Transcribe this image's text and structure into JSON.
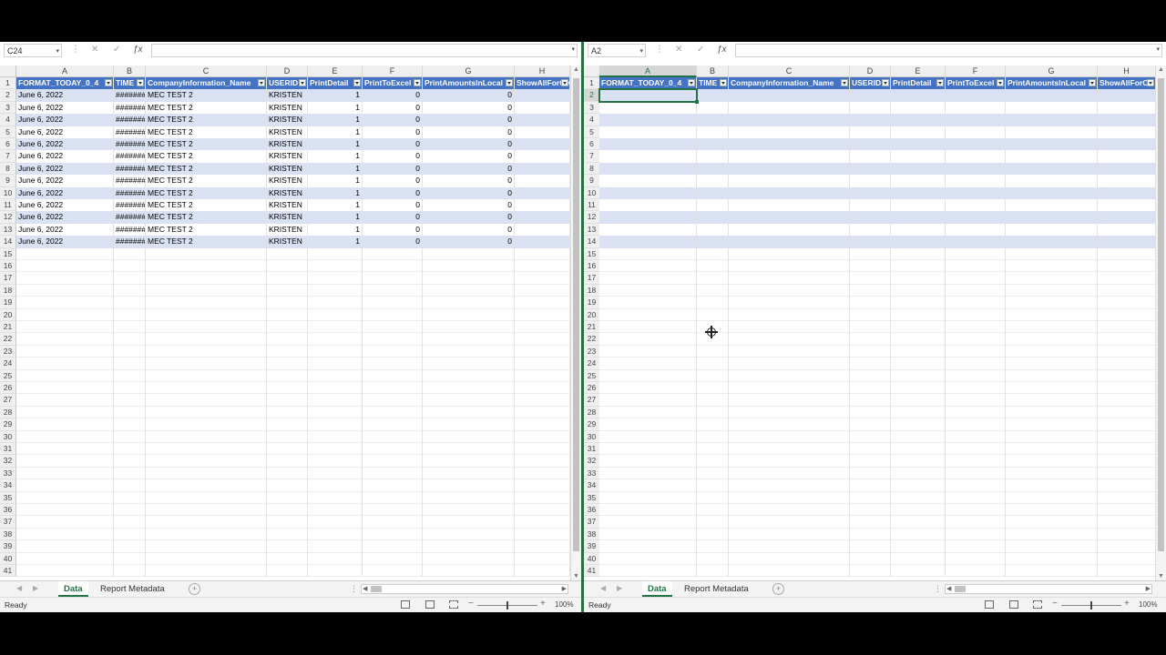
{
  "columns": [
    {
      "letter": "A",
      "header": "FORMAT_TODAY_0_4",
      "align": "left"
    },
    {
      "letter": "B",
      "header": "TIME",
      "align": "left"
    },
    {
      "letter": "C",
      "header": "CompanyInformation_Name",
      "align": "left"
    },
    {
      "letter": "D",
      "header": "USERID",
      "align": "left"
    },
    {
      "letter": "E",
      "header": "PrintDetail",
      "align": "right"
    },
    {
      "letter": "F",
      "header": "PrintToExcel",
      "align": "right"
    },
    {
      "letter": "G",
      "header": "PrintAmountsInLocal",
      "align": "right"
    },
    {
      "letter": "H",
      "header": "ShowAllForOv",
      "align": "left"
    }
  ],
  "left": {
    "name_box": "C24",
    "data_rows": [
      [
        "June 6, 2022",
        "########",
        "MEC TEST 2",
        "KRISTEN",
        "1",
        "0",
        "0",
        ""
      ],
      [
        "June 6, 2022",
        "########",
        "MEC TEST 2",
        "KRISTEN",
        "1",
        "0",
        "0",
        ""
      ],
      [
        "June 6, 2022",
        "########",
        "MEC TEST 2",
        "KRISTEN",
        "1",
        "0",
        "0",
        ""
      ],
      [
        "June 6, 2022",
        "########",
        "MEC TEST 2",
        "KRISTEN",
        "1",
        "0",
        "0",
        ""
      ],
      [
        "June 6, 2022",
        "########",
        "MEC TEST 2",
        "KRISTEN",
        "1",
        "0",
        "0",
        ""
      ],
      [
        "June 6, 2022",
        "########",
        "MEC TEST 2",
        "KRISTEN",
        "1",
        "0",
        "0",
        ""
      ],
      [
        "June 6, 2022",
        "########",
        "MEC TEST 2",
        "KRISTEN",
        "1",
        "0",
        "0",
        ""
      ],
      [
        "June 6, 2022",
        "########",
        "MEC TEST 2",
        "KRISTEN",
        "1",
        "0",
        "0",
        ""
      ],
      [
        "June 6, 2022",
        "########",
        "MEC TEST 2",
        "KRISTEN",
        "1",
        "0",
        "0",
        ""
      ],
      [
        "June 6, 2022",
        "########",
        "MEC TEST 2",
        "KRISTEN",
        "1",
        "0",
        "0",
        ""
      ],
      [
        "June 6, 2022",
        "########",
        "MEC TEST 2",
        "KRISTEN",
        "1",
        "0",
        "0",
        ""
      ],
      [
        "June 6, 2022",
        "########",
        "MEC TEST 2",
        "KRISTEN",
        "1",
        "0",
        "0",
        ""
      ],
      [
        "June 6, 2022",
        "########",
        "MEC TEST 2",
        "KRISTEN",
        "1",
        "0",
        "0",
        ""
      ]
    ]
  },
  "right": {
    "name_box": "A2",
    "selected_cell": "A2",
    "data_rows": [
      [
        "",
        "",
        "",
        "",
        "",
        "",
        "",
        ""
      ],
      [
        "",
        "",
        "",
        "",
        "",
        "",
        "",
        ""
      ],
      [
        "",
        "",
        "",
        "",
        "",
        "",
        "",
        ""
      ],
      [
        "",
        "",
        "",
        "",
        "",
        "",
        "",
        ""
      ],
      [
        "",
        "",
        "",
        "",
        "",
        "",
        "",
        ""
      ],
      [
        "",
        "",
        "",
        "",
        "",
        "",
        "",
        ""
      ],
      [
        "",
        "",
        "",
        "",
        "",
        "",
        "",
        ""
      ],
      [
        "",
        "",
        "",
        "",
        "",
        "",
        "",
        ""
      ],
      [
        "",
        "",
        "",
        "",
        "",
        "",
        "",
        ""
      ],
      [
        "",
        "",
        "",
        "",
        "",
        "",
        "",
        ""
      ],
      [
        "",
        "",
        "",
        "",
        "",
        "",
        "",
        ""
      ],
      [
        "",
        "",
        "",
        "",
        "",
        "",
        "",
        ""
      ],
      [
        "",
        "",
        "",
        "",
        "",
        "",
        "",
        ""
      ]
    ]
  },
  "total_rows_visible": 41,
  "sheets": {
    "tabs": [
      "Data",
      "Report Metadata"
    ],
    "active": "Data"
  },
  "status": {
    "ready": "Ready",
    "zoom": "100%"
  },
  "colors": {
    "accent": "#217346",
    "table_header": "#4472c4",
    "table_band": "#d9e1f2"
  },
  "icons": [
    "cancel-icon",
    "enter-icon",
    "function-icon",
    "add-sheet-icon",
    "normal-view-icon",
    "page-layout-icon",
    "page-break-icon",
    "crosshair-cursor-icon"
  ]
}
